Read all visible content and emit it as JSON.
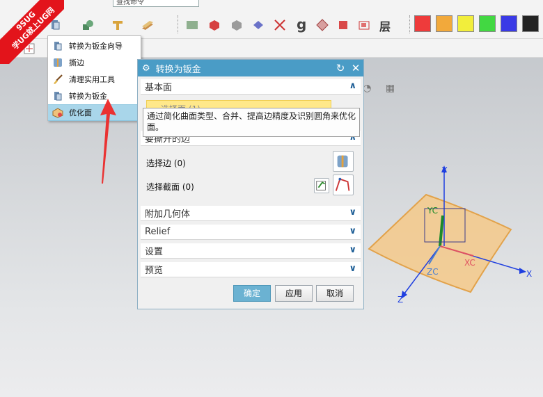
{
  "toolbar": {
    "search_placeholder": "查找命令",
    "layer_label": "层",
    "colors": [
      "#ee3b3b",
      "#f2a93b",
      "#f2ee3b",
      "#42d842",
      "#3a3ae6",
      "#222222"
    ]
  },
  "watermark": {
    "line1": "9SUG",
    "line2": "学UG就上UG网"
  },
  "menu": {
    "items": [
      {
        "label": "转换为钣金向导",
        "icon": "sheetmetal-wizard-icon"
      },
      {
        "label": "撕边",
        "icon": "rip-edge-icon"
      },
      {
        "label": "清理实用工具",
        "icon": "cleanup-brush-icon"
      },
      {
        "label": "转换为钣金",
        "icon": "convert-sheetmetal-icon"
      },
      {
        "label": "优化面",
        "icon": "optimize-face-icon"
      }
    ],
    "selected_index": 4
  },
  "dialog": {
    "title": "转换为钣金",
    "sections": {
      "base_face": "基本面",
      "edges_to_rip": "要撕开的边",
      "additional_geometry": "附加几何体",
      "relief": "Relief",
      "settings": "设置",
      "preview": "预览"
    },
    "select_face": "选择面 (1)",
    "select_edge": "选择边 (0)",
    "select_section": "选择截面 (0)",
    "tooltip": "通过简化曲面类型、合并、提高边精度及识别圆角来优化面。",
    "buttons": {
      "ok": "确定",
      "apply": "应用",
      "cancel": "取消"
    }
  },
  "scene": {
    "axes": {
      "x": "X",
      "y": "Y",
      "z": "Z",
      "xc": "XC",
      "yc": "YC",
      "zc": "ZC"
    },
    "surface_color": "#f5c98a",
    "axis_color": "#1f3fe0"
  }
}
